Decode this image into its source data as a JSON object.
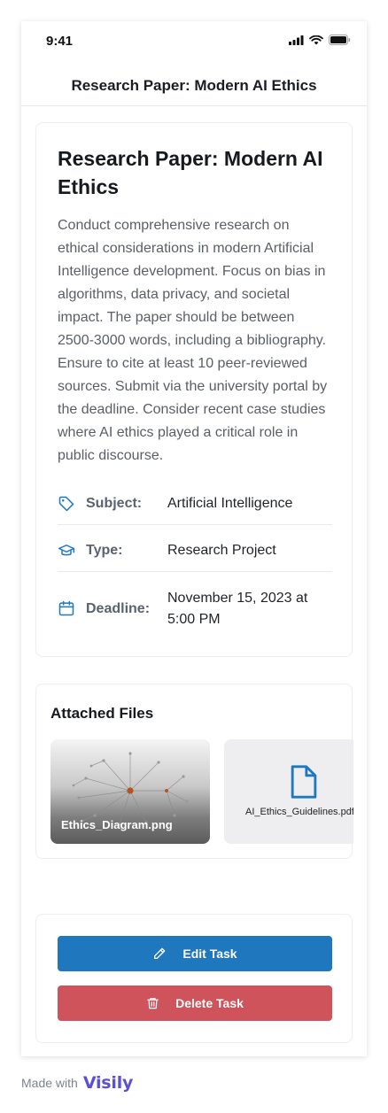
{
  "status_bar": {
    "time": "9:41"
  },
  "nav": {
    "title": "Research Paper: Modern AI Ethics"
  },
  "task": {
    "title": "Research Paper: Modern AI Ethics",
    "description": "Conduct comprehensive research on ethical considerations in modern Artificial Intelligence development. Focus on bias in algorithms, data privacy, and societal impact. The paper should be between 2500-3000 words, including a bibliography. Ensure to cite at least 10 peer-reviewed sources. Submit via the university portal by the deadline. Consider recent case studies where AI ethics played a critical role in public discourse.",
    "meta": [
      {
        "icon": "tag-icon",
        "label": "Subject:",
        "value": "Artificial Intelligence"
      },
      {
        "icon": "graduation-cap-icon",
        "label": "Type:",
        "value": "Research Project"
      },
      {
        "icon": "calendar-icon",
        "label": "Deadline:",
        "value": "November 15, 2023 at 5:00 PM"
      }
    ]
  },
  "files": {
    "title": "Attached Files",
    "items": [
      {
        "name": "Ethics_Diagram.png",
        "kind": "image"
      },
      {
        "name": "AI_Ethics_Guidelines.pdf",
        "kind": "document",
        "icon": "file-icon"
      }
    ]
  },
  "actions": {
    "edit_label": "Edit Task",
    "delete_label": "Delete Task"
  },
  "footer": {
    "made_with": "Made with",
    "brand": "Visily"
  },
  "colors": {
    "primary": "#1f78bd",
    "danger": "#cf535a",
    "brand": "#5b4fd6"
  }
}
